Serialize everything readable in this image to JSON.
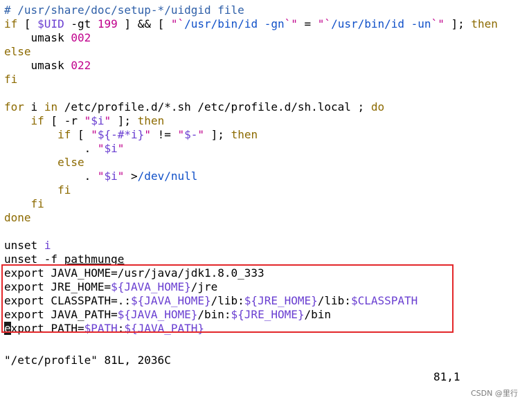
{
  "lines": [
    {
      "tokens": [
        {
          "t": "# /usr/share/doc/setup-*/uidgid file",
          "c": "comment"
        }
      ]
    },
    {
      "tokens": [
        {
          "t": "if",
          "c": "keyword"
        },
        {
          "t": " [ ",
          "c": "plain"
        },
        {
          "t": "$UID",
          "c": "var"
        },
        {
          "t": " -gt ",
          "c": "plain"
        },
        {
          "t": "199",
          "c": "number"
        },
        {
          "t": " ] ",
          "c": "plain"
        },
        {
          "t": "&&",
          "c": "plain"
        },
        {
          "t": " [ ",
          "c": "plain"
        },
        {
          "t": "\"`",
          "c": "string"
        },
        {
          "t": "/usr/bin/id -gn",
          "c": "path"
        },
        {
          "t": "`\"",
          "c": "string"
        },
        {
          "t": " = ",
          "c": "plain"
        },
        {
          "t": "\"`",
          "c": "string"
        },
        {
          "t": "/usr/bin/id -un",
          "c": "path"
        },
        {
          "t": "`\"",
          "c": "string"
        },
        {
          "t": " ]; ",
          "c": "plain"
        },
        {
          "t": "then",
          "c": "keyword"
        }
      ]
    },
    {
      "tokens": [
        {
          "t": "    umask ",
          "c": "plain"
        },
        {
          "t": "002",
          "c": "number"
        }
      ]
    },
    {
      "tokens": [
        {
          "t": "else",
          "c": "keyword"
        }
      ]
    },
    {
      "tokens": [
        {
          "t": "    umask ",
          "c": "plain"
        },
        {
          "t": "022",
          "c": "number"
        }
      ]
    },
    {
      "tokens": [
        {
          "t": "fi",
          "c": "keyword"
        }
      ]
    },
    {
      "tokens": []
    },
    {
      "tokens": [
        {
          "t": "for",
          "c": "keyword"
        },
        {
          "t": " i ",
          "c": "plain"
        },
        {
          "t": "in",
          "c": "keyword"
        },
        {
          "t": " /etc/profile.d/*.sh /etc/profile.d/sh.local ; ",
          "c": "plain"
        },
        {
          "t": "do",
          "c": "keyword"
        }
      ]
    },
    {
      "tokens": [
        {
          "t": "    ",
          "c": "plain"
        },
        {
          "t": "if",
          "c": "keyword"
        },
        {
          "t": " [ -r ",
          "c": "plain"
        },
        {
          "t": "\"",
          "c": "string"
        },
        {
          "t": "$i",
          "c": "var"
        },
        {
          "t": "\"",
          "c": "string"
        },
        {
          "t": " ]; ",
          "c": "plain"
        },
        {
          "t": "then",
          "c": "keyword"
        }
      ]
    },
    {
      "tokens": [
        {
          "t": "        ",
          "c": "plain"
        },
        {
          "t": "if",
          "c": "keyword"
        },
        {
          "t": " [ ",
          "c": "plain"
        },
        {
          "t": "\"",
          "c": "string"
        },
        {
          "t": "${-#*i}",
          "c": "var"
        },
        {
          "t": "\"",
          "c": "string"
        },
        {
          "t": " != ",
          "c": "plain"
        },
        {
          "t": "\"",
          "c": "string"
        },
        {
          "t": "$-",
          "c": "var"
        },
        {
          "t": "\"",
          "c": "string"
        },
        {
          "t": " ]; ",
          "c": "plain"
        },
        {
          "t": "then",
          "c": "keyword"
        }
      ]
    },
    {
      "tokens": [
        {
          "t": "            . ",
          "c": "plain"
        },
        {
          "t": "\"",
          "c": "string"
        },
        {
          "t": "$i",
          "c": "var"
        },
        {
          "t": "\"",
          "c": "string"
        }
      ]
    },
    {
      "tokens": [
        {
          "t": "        ",
          "c": "plain"
        },
        {
          "t": "else",
          "c": "keyword"
        }
      ]
    },
    {
      "tokens": [
        {
          "t": "            . ",
          "c": "plain"
        },
        {
          "t": "\"",
          "c": "string"
        },
        {
          "t": "$i",
          "c": "var"
        },
        {
          "t": "\"",
          "c": "string"
        },
        {
          "t": " >",
          "c": "plain"
        },
        {
          "t": "/dev/null",
          "c": "path"
        }
      ]
    },
    {
      "tokens": [
        {
          "t": "        ",
          "c": "plain"
        },
        {
          "t": "fi",
          "c": "keyword"
        }
      ]
    },
    {
      "tokens": [
        {
          "t": "    ",
          "c": "plain"
        },
        {
          "t": "fi",
          "c": "keyword"
        }
      ]
    },
    {
      "tokens": [
        {
          "t": "done",
          "c": "keyword"
        }
      ]
    },
    {
      "tokens": []
    },
    {
      "tokens": [
        {
          "t": "unset",
          "c": "plain"
        },
        {
          "t": " ",
          "c": "plain"
        },
        {
          "t": "i",
          "c": "var"
        }
      ]
    },
    {
      "tokens": [
        {
          "t": "unset -f ",
          "c": "plain"
        },
        {
          "t": "pathmunge",
          "c": "under"
        }
      ]
    },
    {
      "tokens": [
        {
          "t": "export",
          "c": "plain"
        },
        {
          "t": " JAVA_HOME=/usr/java/jdk1.8.0_333",
          "c": "plain"
        }
      ]
    },
    {
      "tokens": [
        {
          "t": "export",
          "c": "plain"
        },
        {
          "t": " JRE_HOME=",
          "c": "plain"
        },
        {
          "t": "${JAVA_HOME}",
          "c": "var"
        },
        {
          "t": "/jre",
          "c": "plain"
        }
      ]
    },
    {
      "tokens": [
        {
          "t": "export",
          "c": "plain"
        },
        {
          "t": " CLASSPATH=.:",
          "c": "plain"
        },
        {
          "t": "${JAVA_HOME}",
          "c": "var"
        },
        {
          "t": "/lib:",
          "c": "plain"
        },
        {
          "t": "${JRE_HOME}",
          "c": "var"
        },
        {
          "t": "/lib:",
          "c": "plain"
        },
        {
          "t": "$CLASSPATH",
          "c": "var"
        }
      ]
    },
    {
      "tokens": [
        {
          "t": "export",
          "c": "plain"
        },
        {
          "t": " JAVA_PATH=",
          "c": "plain"
        },
        {
          "t": "${JAVA_HOME}",
          "c": "var"
        },
        {
          "t": "/bin:",
          "c": "plain"
        },
        {
          "t": "${JRE_HOME}",
          "c": "var"
        },
        {
          "t": "/bin",
          "c": "plain"
        }
      ]
    },
    {
      "tokens": [
        {
          "t": "e",
          "c": "cursor"
        },
        {
          "t": "xport",
          "c": "plain"
        },
        {
          "t": " PATH=",
          "c": "plain"
        },
        {
          "t": "$PATH",
          "c": "var"
        },
        {
          "t": ":",
          "c": "plain"
        },
        {
          "t": "${JAVA_PATH}",
          "c": "var"
        }
      ]
    }
  ],
  "status": {
    "message": "\"/etc/profile\" 81L, 2036C",
    "position": "81,1"
  },
  "watermark": "CSDN @里行"
}
